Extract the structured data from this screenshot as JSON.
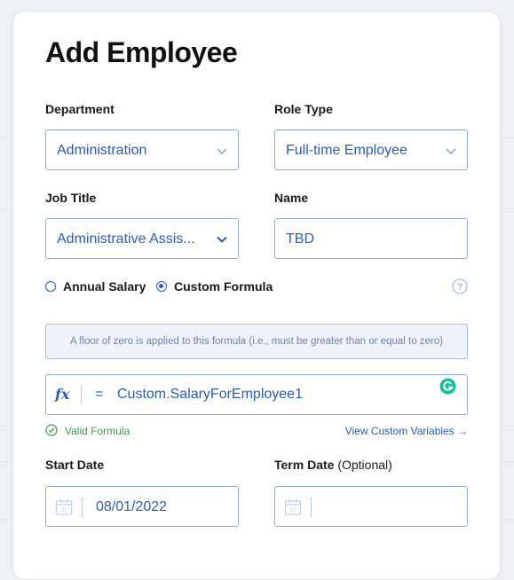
{
  "form": {
    "title": "Add Employee",
    "department": {
      "label": "Department",
      "value": "Administration"
    },
    "role_type": {
      "label": "Role Type",
      "value": "Full-time Employee"
    },
    "job_title": {
      "label": "Job Title",
      "value": "Administrative Assis..."
    },
    "name": {
      "label": "Name",
      "value": "TBD"
    },
    "salary_options": {
      "annual": "Annual Salary",
      "custom": "Custom Formula",
      "selected": "custom"
    },
    "notice": "A floor of zero is applied to this formula (i.e., must be greater than or equal to zero)",
    "formula": {
      "fx": "fx",
      "equals": "=",
      "value": "Custom.SalaryForEmployee1"
    },
    "valid_text": "Valid Formula",
    "view_vars_link": "View Custom Variables →",
    "start_date": {
      "label": "Start Date",
      "value": "08/01/2022"
    },
    "term_date": {
      "label": "Term Date",
      "optional": "(Optional)",
      "value": ""
    }
  },
  "icons": {
    "chevron": "chevron-down-icon",
    "help": "question-circle-icon",
    "calendar": "calendar-icon",
    "grammarly": "grammarly-icon",
    "check": "check-circle-icon"
  },
  "colors": {
    "accent": "#2a5bb8",
    "border": "#8fa9d6",
    "valid": "#3a9a4a",
    "notice_bg": "#eef3fc"
  }
}
